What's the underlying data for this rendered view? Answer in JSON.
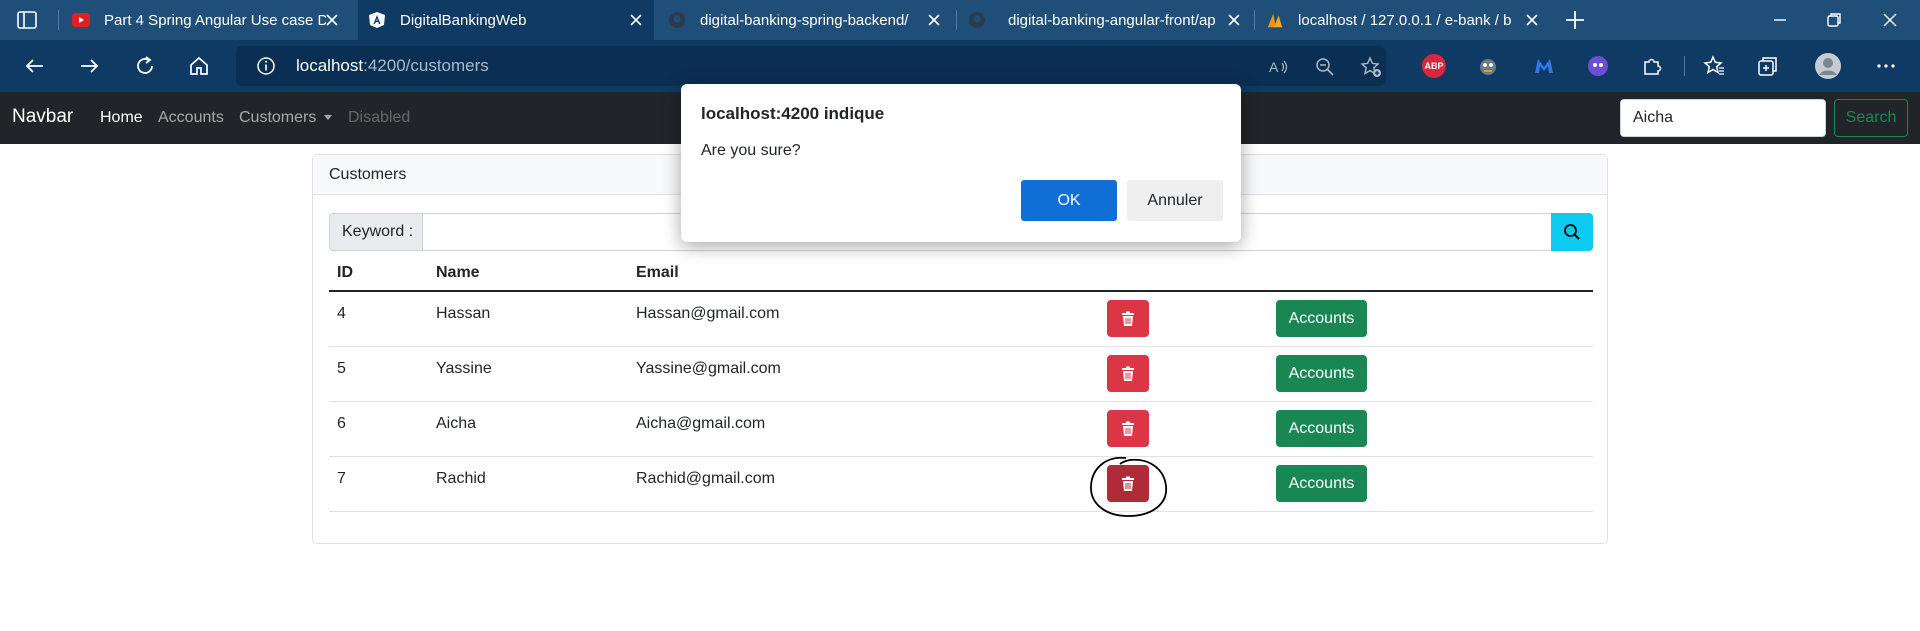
{
  "browser": {
    "tabs": [
      {
        "title": "Part 4 Spring Angular Use case D",
        "favicon": "youtube-icon",
        "active": false
      },
      {
        "title": "DigitalBankingWeb",
        "favicon": "angular-icon",
        "active": true
      },
      {
        "title": "digital-banking-spring-backend/",
        "favicon": "github-icon",
        "active": false
      },
      {
        "title": "digital-banking-angular-front/ap",
        "favicon": "github-icon",
        "active": false
      },
      {
        "title": "localhost / 127.0.0.1 / e-bank / b",
        "favicon": "phpmyadmin-icon",
        "active": false
      }
    ],
    "address": {
      "host": "localhost",
      "path": ":4200/customers"
    },
    "extensions": {
      "abp_label": "ABP"
    },
    "colors": {
      "tabstrip": "#1f4e79",
      "toolbar": "#0f3a63"
    }
  },
  "navbar": {
    "brand": "Navbar",
    "links": {
      "home": "Home",
      "accounts": "Accounts",
      "customers": "Customers",
      "disabled": "Disabled"
    },
    "search_value": "Aicha",
    "search_button": "Search"
  },
  "card": {
    "header": "Customers",
    "keyword_label": "Keyword :",
    "keyword_value": "",
    "columns": {
      "id": "ID",
      "name": "Name",
      "email": "Email"
    },
    "rows": [
      {
        "id": "4",
        "name": "Hassan",
        "email": "Hassan@gmail.com",
        "accounts_label": "Accounts"
      },
      {
        "id": "5",
        "name": "Yassine",
        "email": "Yassine@gmail.com",
        "accounts_label": "Accounts"
      },
      {
        "id": "6",
        "name": "Aicha",
        "email": "Aicha@gmail.com",
        "accounts_label": "Accounts"
      },
      {
        "id": "7",
        "name": "Rachid",
        "email": "Rachid@gmail.com",
        "accounts_label": "Accounts"
      }
    ]
  },
  "dialog": {
    "title": "localhost:4200 indique",
    "message": "Are you sure?",
    "ok_label": "OK",
    "cancel_label": "Annuler"
  },
  "colors": {
    "danger": "#dc3545",
    "success": "#198754",
    "info": "#0dcaf0",
    "dark": "#212529",
    "dialog_ok": "#0f6fd6"
  }
}
